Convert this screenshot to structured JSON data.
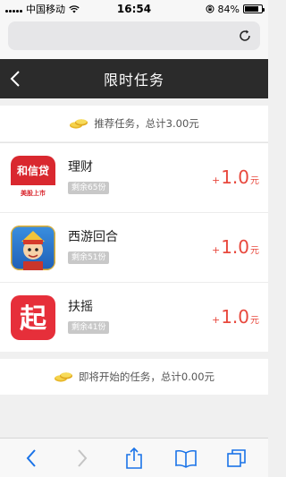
{
  "status_bar": {
    "carrier": "中国移动",
    "time": "16:54",
    "battery": "84%",
    "battery_level": 0.84
  },
  "header": {
    "title": "限时任务"
  },
  "recommended": {
    "summary": "推荐任务，总计3.00元"
  },
  "tasks": [
    {
      "name": "理财",
      "remaining": "剩余65份",
      "reward_plus": "+",
      "reward_amount": "1.0",
      "reward_unit": "元",
      "icon": "hexindai-logo",
      "icon_text": "和信贷",
      "icon_subtext": "美股上市"
    },
    {
      "name": "西游回合",
      "remaining": "剩余51份",
      "reward_plus": "+",
      "reward_amount": "1.0",
      "reward_unit": "元",
      "icon": "xiyou-game-icon"
    },
    {
      "name": "扶摇",
      "remaining": "剩余41份",
      "reward_plus": "+",
      "reward_amount": "1.0",
      "reward_unit": "元",
      "icon": "fuyao-logo",
      "icon_text": "起"
    }
  ],
  "upcoming": {
    "summary": "即将开始的任务，总计0.00元"
  },
  "colors": {
    "header_bg": "#2b2b2b",
    "reward": "#e8483d",
    "toolbar_accent": "#1a73e8"
  }
}
